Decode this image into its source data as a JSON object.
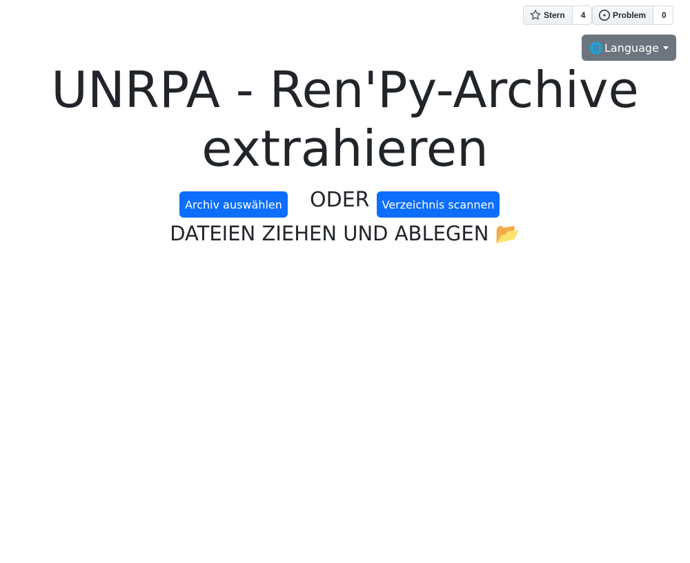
{
  "github": {
    "star": {
      "label": "Stern",
      "count": "4",
      "icon": "star-icon"
    },
    "issue": {
      "label": "Problem",
      "count": "0",
      "icon": "issue-opened-icon"
    }
  },
  "language": {
    "globe": "🌐",
    "label": "Language"
  },
  "heading": {
    "title": "UNRPA - Ren'Py-Archive extrahieren"
  },
  "actions": {
    "select_archive": "Archiv auswählen",
    "or": "ODER",
    "scan_directory": "Verzeichnis scannen"
  },
  "dropzone": {
    "text": "DATEIEN ZIEHEN UND ABLEGEN 📂"
  },
  "colors": {
    "primary": "#0d6efd",
    "secondary": "#6c757d",
    "text": "#212529"
  }
}
